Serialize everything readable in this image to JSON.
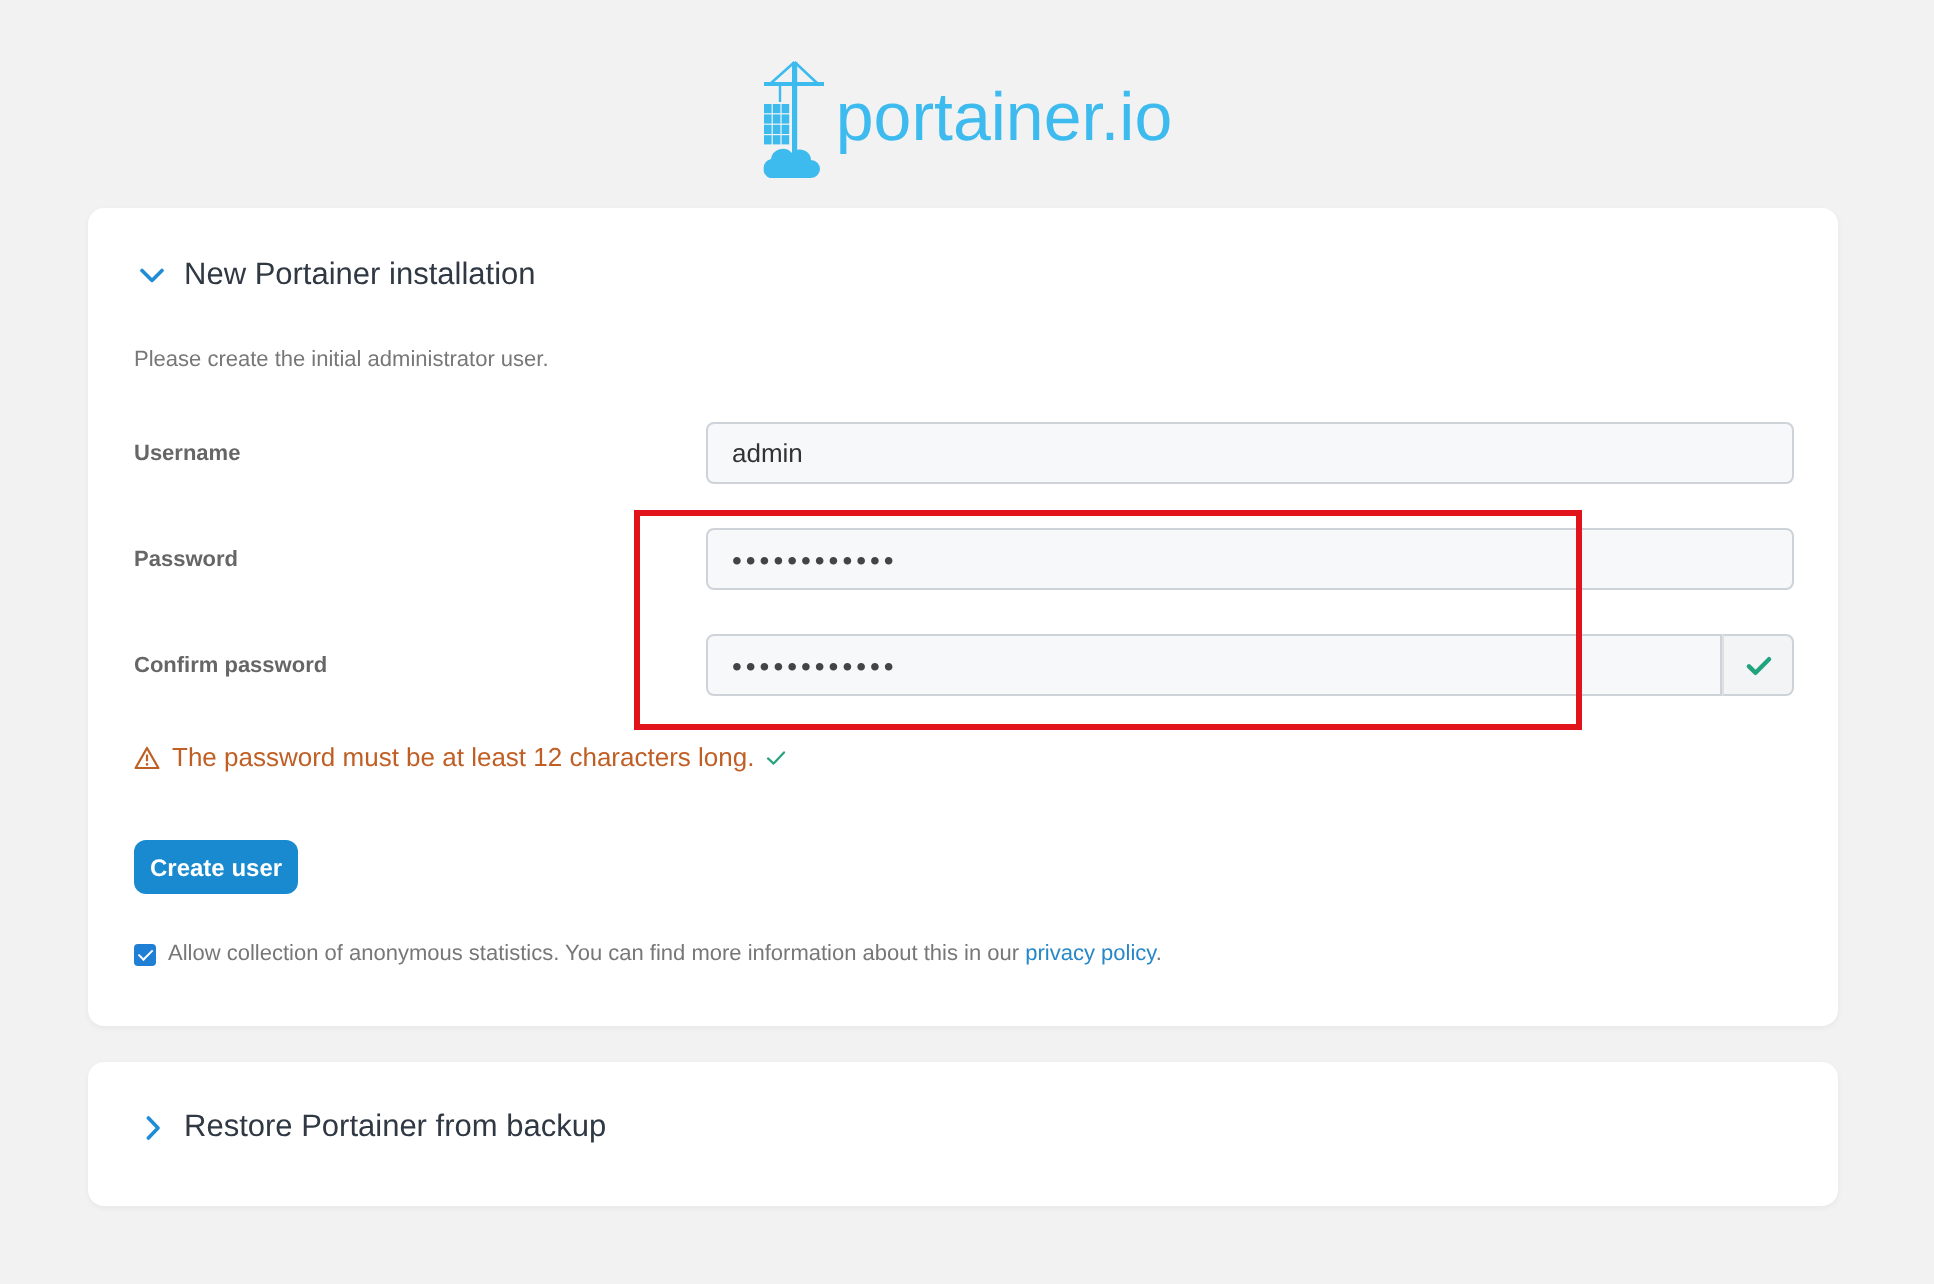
{
  "logo": {
    "text": "portainer.io"
  },
  "sections": [
    {
      "title": "New Portainer installation",
      "expanded": true,
      "description": "Please create the initial administrator user.",
      "fields": [
        {
          "label": "Username",
          "kind": "text",
          "value": "admin",
          "valid": false
        },
        {
          "label": "Password",
          "kind": "password",
          "value": "••••••••••••",
          "valid": false
        },
        {
          "label": "Confirm password",
          "kind": "password",
          "value": "••••••••••••",
          "valid": true
        }
      ],
      "warning": {
        "text": "The password must be at least 12 characters long.",
        "satisfied": true
      },
      "button": "Create user",
      "statistics": {
        "checked": true,
        "text": "Allow collection of anonymous statistics. You can find more information about this in our",
        "link": "privacy policy",
        "end": "."
      },
      "annotation": {
        "kind": "rectangle"
      }
    },
    {
      "title": "Restore Portainer from backup",
      "expanded": false
    }
  ]
}
